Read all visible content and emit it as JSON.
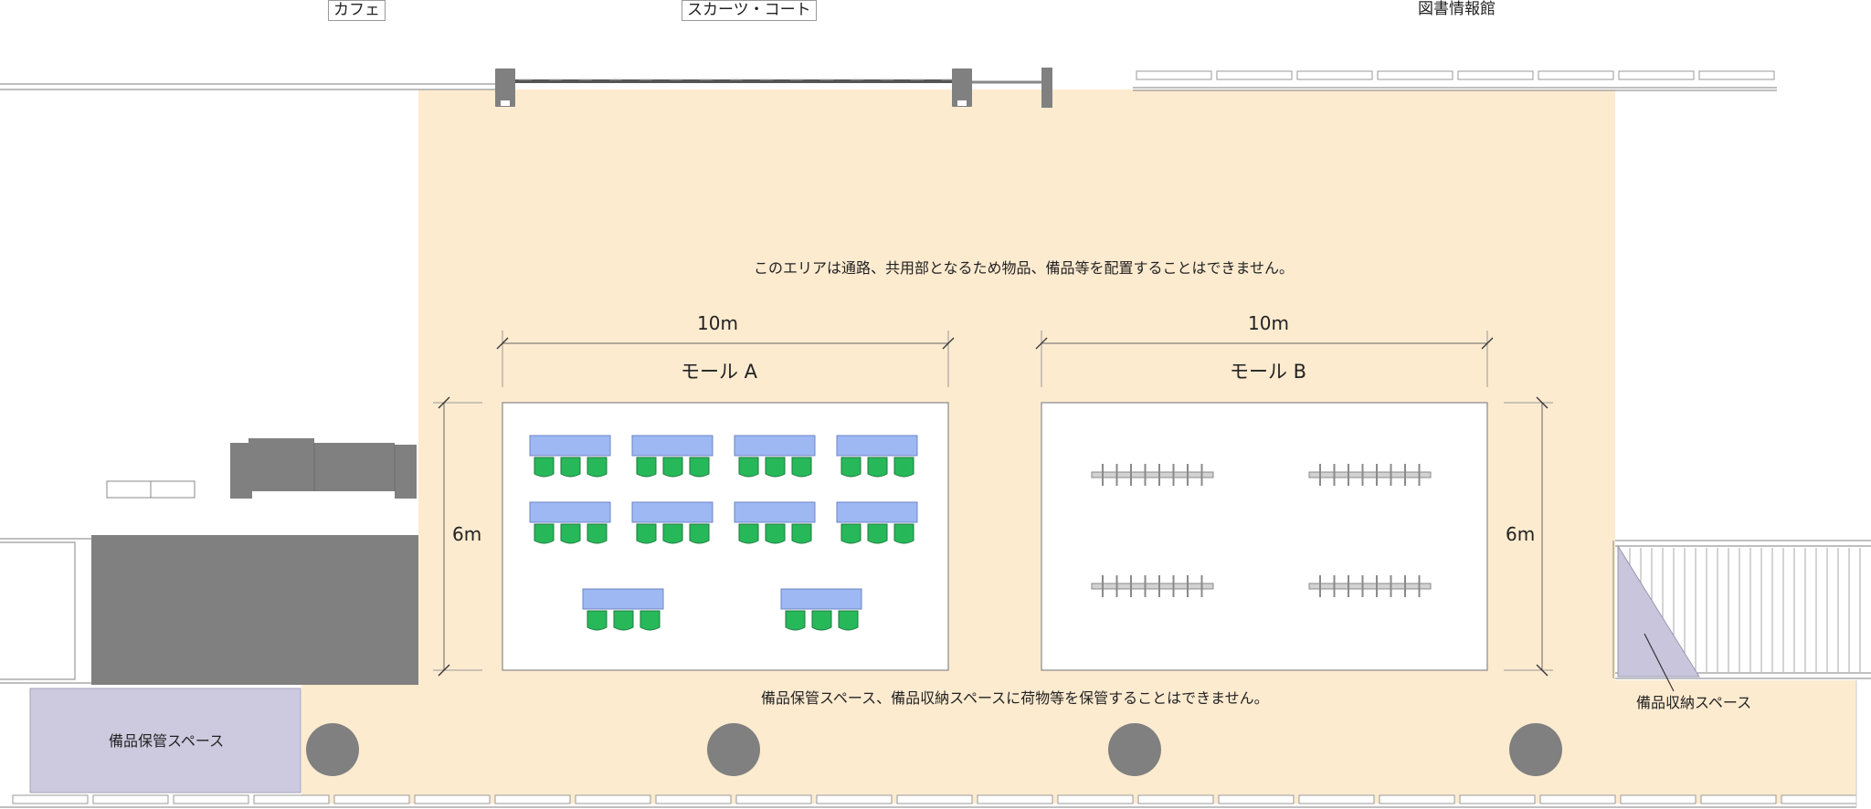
{
  "top_labels": {
    "cafe": "カフェ",
    "sports_court": "スカーツ・コート",
    "library": "図書情報館"
  },
  "notes": {
    "circulation": "このエリアは通路、共用部となるため物品、備品等を配置することはできません。",
    "storage_rule": "備品保管スペース、備品収納スペースに荷物等を保管することはできません。"
  },
  "mall_a": {
    "title": "モール A",
    "width_label": "10m",
    "depth_label": "6m",
    "table_rows": [
      4,
      4,
      2
    ],
    "chairs_per_table": 3
  },
  "mall_b": {
    "title": "モール B",
    "width_label": "10m",
    "depth_label": "6m",
    "fixture_count": 4
  },
  "storage": {
    "equipment_storage": "備品保管スペース",
    "equipment_storage_b": "備品収納スペース"
  },
  "colors": {
    "floor": "#fdebd0",
    "storage": "#cdcadf",
    "table": "#9db8f3",
    "chair": "#27b85a",
    "structure": "#808080"
  }
}
